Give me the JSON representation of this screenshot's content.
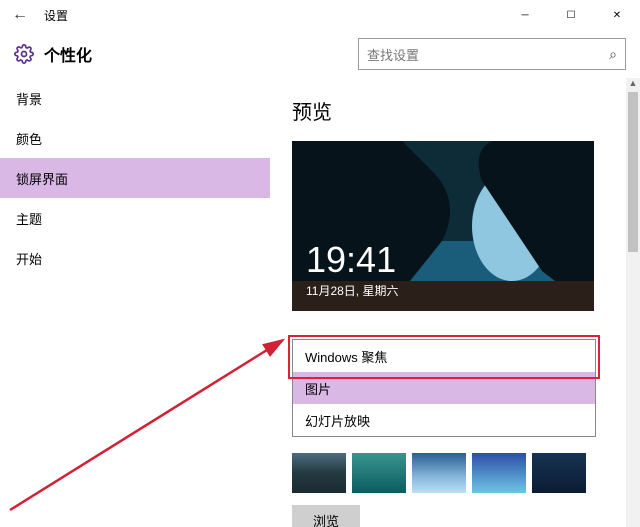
{
  "titlebar": {
    "title": "设置"
  },
  "header": {
    "section": "个性化"
  },
  "search": {
    "placeholder": "查找设置"
  },
  "sidebar": {
    "items": [
      {
        "label": "背景"
      },
      {
        "label": "颜色"
      },
      {
        "label": "锁屏界面"
      },
      {
        "label": "主题"
      },
      {
        "label": "开始"
      }
    ],
    "selected_index": 2
  },
  "content": {
    "preview_heading": "预览",
    "lock_time": "19:41",
    "lock_date": "11月28日, 星期六",
    "browse_label": "浏览"
  },
  "background_options": {
    "items": [
      {
        "label": "Windows 聚焦"
      },
      {
        "label": "图片"
      },
      {
        "label": "幻灯片放映"
      }
    ],
    "selected_index": 1,
    "highlighted_red_index": 0
  },
  "colors": {
    "accent": "#d9b8e6",
    "annotation_red": "#d22035"
  }
}
